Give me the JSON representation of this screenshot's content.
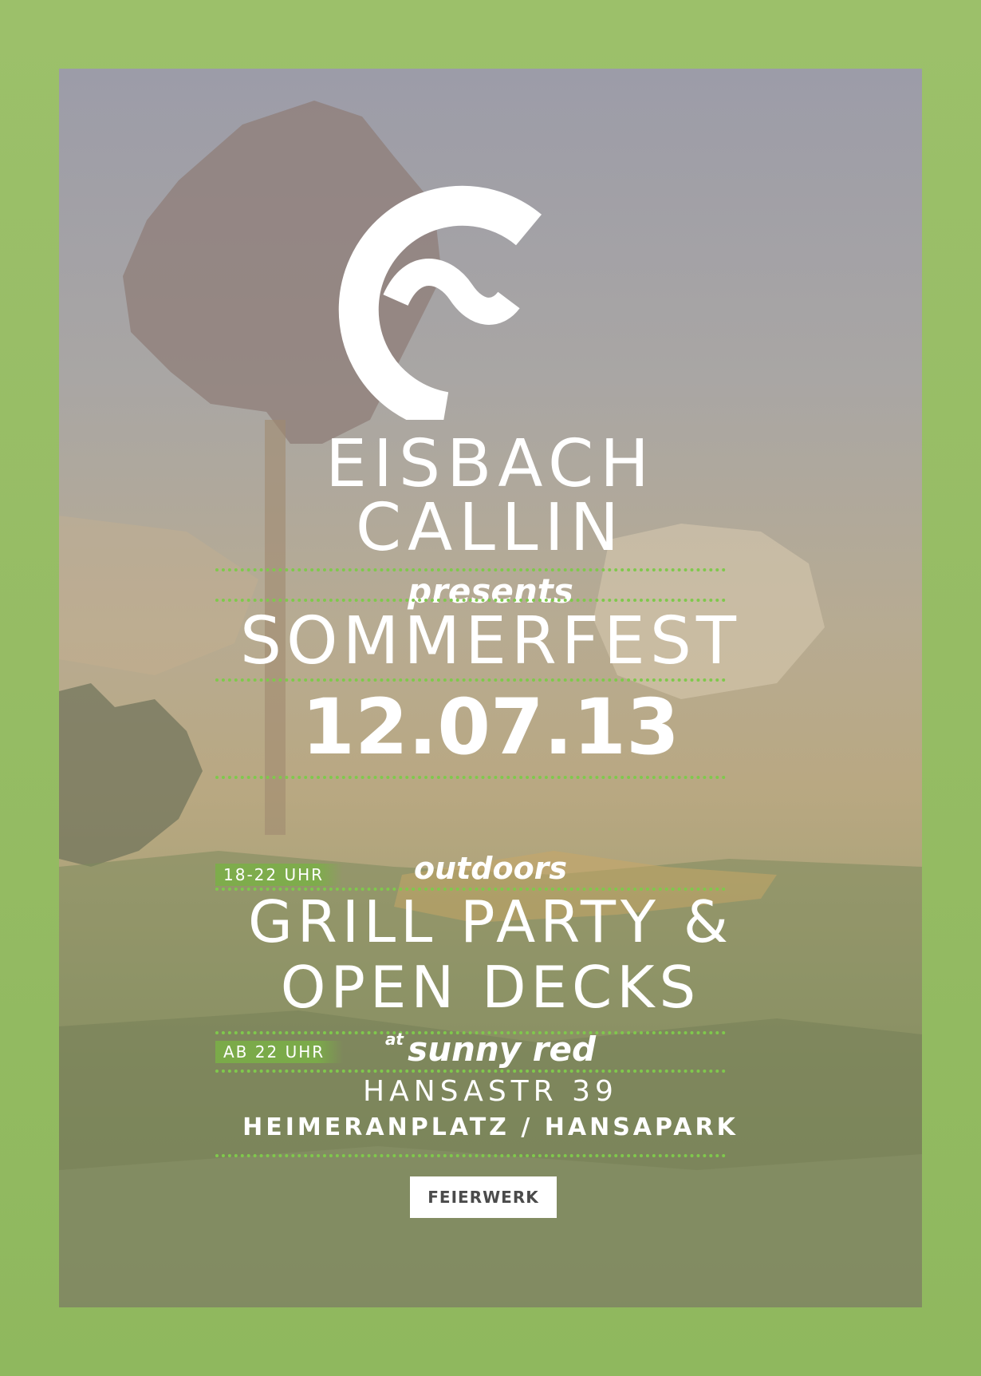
{
  "brand": {
    "name_line1": "EISBACH",
    "name_line2": "CALLIN",
    "logo": "eisbach-callin-logo"
  },
  "presents": "presents",
  "event": {
    "title": "SOMMERFEST",
    "date": "12.07.13"
  },
  "part1": {
    "time_badge": "18-22 UHR",
    "label": "outdoors",
    "line1": "GRILL PARTY &",
    "line2": "OPEN DECKS"
  },
  "part2": {
    "time_badge": "AB 22 UHR",
    "at": "at",
    "venue": "sunny red"
  },
  "address": {
    "street": "HANSASTR 39",
    "area": "HEIMERANPLATZ / HANSAPARK"
  },
  "sponsor": {
    "label": "FEIERWERK"
  },
  "colors": {
    "border": "#93b864",
    "accent": "#7fc94c",
    "text": "#ffffff"
  }
}
